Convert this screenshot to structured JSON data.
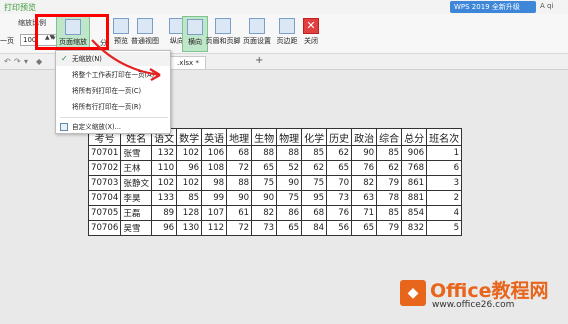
{
  "window": {
    "title": "打印预览",
    "badge": "WPS 2019 全新升级",
    "user": "A qi"
  },
  "ribbon": {
    "zoom_label": "缩放比例",
    "page_label": "一页",
    "zoom_value": "100",
    "buttons": [
      "页面缩放",
      "分",
      "预览",
      "普通视图",
      "纵向",
      "横向",
      "页眉和页脚",
      "页面设置",
      "页边距",
      "关闭"
    ]
  },
  "tabs": {
    "file": ".xlsx *"
  },
  "menu": {
    "items": [
      "无缩放(N)",
      "将整个工作表打印在一页(A)",
      "将所有列打印在一页(C)",
      "将所有行打印在一页(R)",
      "自定义缩放(X)..."
    ]
  },
  "table": {
    "headers": [
      "考号",
      "姓名",
      "语文",
      "数学",
      "英语",
      "地理",
      "生物",
      "物理",
      "化学",
      "历史",
      "政治",
      "综合",
      "总分",
      "班名次"
    ],
    "rows": [
      [
        "70701",
        "张雪",
        "132",
        "102",
        "106",
        "68",
        "88",
        "88",
        "85",
        "62",
        "90",
        "85",
        "906",
        "1"
      ],
      [
        "70702",
        "王林",
        "110",
        "96",
        "108",
        "72",
        "65",
        "52",
        "62",
        "65",
        "76",
        "62",
        "768",
        "6"
      ],
      [
        "70703",
        "张静文",
        "102",
        "102",
        "98",
        "88",
        "75",
        "90",
        "75",
        "70",
        "82",
        "79",
        "861",
        "3"
      ],
      [
        "70704",
        "李昊",
        "133",
        "85",
        "99",
        "90",
        "90",
        "75",
        "95",
        "73",
        "63",
        "78",
        "881",
        "2"
      ],
      [
        "70705",
        "王磊",
        "89",
        "128",
        "107",
        "61",
        "82",
        "86",
        "68",
        "76",
        "71",
        "85",
        "854",
        "4"
      ],
      [
        "70706",
        "吴雪",
        "96",
        "130",
        "112",
        "72",
        "73",
        "65",
        "84",
        "56",
        "65",
        "79",
        "832",
        "5"
      ]
    ]
  },
  "watermark": {
    "title": "Office教程网",
    "url": "www.office26.com"
  },
  "colors": {
    "accent": "#e8651c",
    "highlight": "#ff0000",
    "wps_blue": "#3d86d8"
  }
}
